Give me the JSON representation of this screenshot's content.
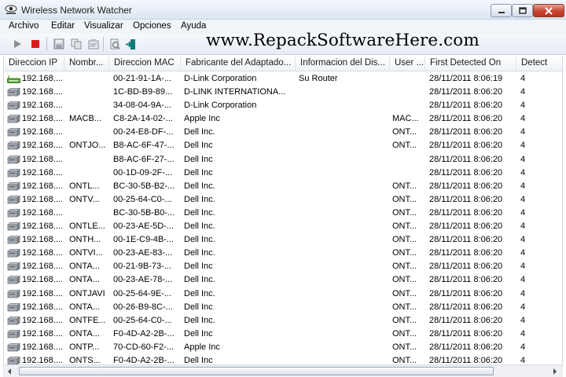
{
  "window": {
    "title": "Wireless Network Watcher",
    "icon": "eye-network-icon"
  },
  "menu": [
    "Archivo",
    "Editar",
    "Visualizar",
    "Opciones",
    "Ayuda"
  ],
  "toolbar": {
    "buttons": [
      "play-icon",
      "stop-icon",
      "save-icon",
      "copy-icon",
      "properties-icon",
      "refresh-icon",
      "exit-icon"
    ]
  },
  "watermark": "www.RepackSoftwareHere.com",
  "columns": [
    "Direccion IP",
    "Nombr...",
    "Direccion MAC",
    "Fabricante del Adaptado...",
    "Informacion del Dis...",
    "User ...",
    "First Detected On",
    "Detect"
  ],
  "rows": [
    [
      "192.168....",
      "",
      "00-21-91-1A-...",
      "D-Link Corporation",
      "Su Router",
      "",
      "28/11/2011 8:06:19",
      "4"
    ],
    [
      "192.168....",
      "",
      "1C-BD-B9-89...",
      "D-LINK INTERNATIONA...",
      "",
      "",
      "28/11/2011 8:06:20",
      "4"
    ],
    [
      "192.168....",
      "",
      "34-08-04-9A-...",
      "D-Link Corporation",
      "",
      "",
      "28/11/2011 8:06:20",
      "4"
    ],
    [
      "192.168....",
      "MACB...",
      "C8-2A-14-02-...",
      "Apple Inc",
      "",
      "MAC...",
      "28/11/2011 8:06:20",
      "4"
    ],
    [
      "192.168....",
      "",
      "00-24-E8-DF-...",
      "Dell Inc.",
      "",
      "ONT...",
      "28/11/2011 8:06:20",
      "4"
    ],
    [
      "192.168....",
      "ONTJO...",
      "B8-AC-6F-47-...",
      "Dell Inc",
      "",
      "ONT...",
      "28/11/2011 8:06:20",
      "4"
    ],
    [
      "192.168....",
      "",
      "B8-AC-6F-27-...",
      "Dell Inc",
      "",
      "",
      "28/11/2011 8:06:20",
      "4"
    ],
    [
      "192.168....",
      "",
      "00-1D-09-2F-...",
      "Dell Inc",
      "",
      "",
      "28/11/2011 8:06:20",
      "4"
    ],
    [
      "192.168....",
      "ONTL...",
      "BC-30-5B-B2-...",
      "Dell Inc.",
      "",
      "ONT...",
      "28/11/2011 8:06:20",
      "4"
    ],
    [
      "192.168....",
      "ONTV...",
      "00-25-64-C0-...",
      "Dell Inc.",
      "",
      "ONT...",
      "28/11/2011 8:06:20",
      "4"
    ],
    [
      "192.168....",
      "",
      "BC-30-5B-B0-...",
      "Dell Inc.",
      "",
      "ONT...",
      "28/11/2011 8:06:20",
      "4"
    ],
    [
      "192.168....",
      "ONTLE...",
      "00-23-AE-5D-...",
      "Dell Inc.",
      "",
      "ONT...",
      "28/11/2011 8:06:20",
      "4"
    ],
    [
      "192.168....",
      "ONTH...",
      "00-1E-C9-4B-...",
      "Dell Inc.",
      "",
      "ONT...",
      "28/11/2011 8:06:20",
      "4"
    ],
    [
      "192.168....",
      "ONTVI...",
      "00-23-AE-83-...",
      "Dell Inc.",
      "",
      "ONT...",
      "28/11/2011 8:06:20",
      "4"
    ],
    [
      "192.168....",
      "ONTA...",
      "00-21-9B-73-...",
      "Dell Inc",
      "",
      "ONT...",
      "28/11/2011 8:06:20",
      "4"
    ],
    [
      "192.168....",
      "ONTA...",
      "00-23-AE-78-...",
      "Dell Inc.",
      "",
      "ONT...",
      "28/11/2011 8:06:20",
      "4"
    ],
    [
      "192.168....",
      "ONTJAVI",
      "00-25-64-9E-...",
      "Dell Inc.",
      "",
      "ONT...",
      "28/11/2011 8:06:20",
      "4"
    ],
    [
      "192.168....",
      "ONTA...",
      "00-26-B9-8C-...",
      "Dell Inc",
      "",
      "ONT...",
      "28/11/2011 8:06:20",
      "4"
    ],
    [
      "192.168....",
      "ONTFE...",
      "00-25-64-C0-...",
      "Dell Inc.",
      "",
      "ONT...",
      "28/11/2011 8:06:20",
      "4"
    ],
    [
      "192.168....",
      "ONTA...",
      "F0-4D-A2-2B-...",
      "Dell Inc",
      "",
      "ONT...",
      "28/11/2011 8:06:20",
      "4"
    ],
    [
      "192.168....",
      "ONTP...",
      "70-CD-60-F2-...",
      "Apple Inc",
      "",
      "ONT...",
      "28/11/2011 8:06:20",
      "4"
    ],
    [
      "192.168....",
      "ONTS...",
      "F0-4D-A2-2B-...",
      "Dell Inc",
      "",
      "ONT...",
      "28/11/2011 8:06:20",
      "4"
    ]
  ],
  "colors": {
    "router_icon": "#5aa83a",
    "computer_icon": "#8a8f96",
    "stop": "#d81c1c",
    "play": "#8c8c8c"
  }
}
